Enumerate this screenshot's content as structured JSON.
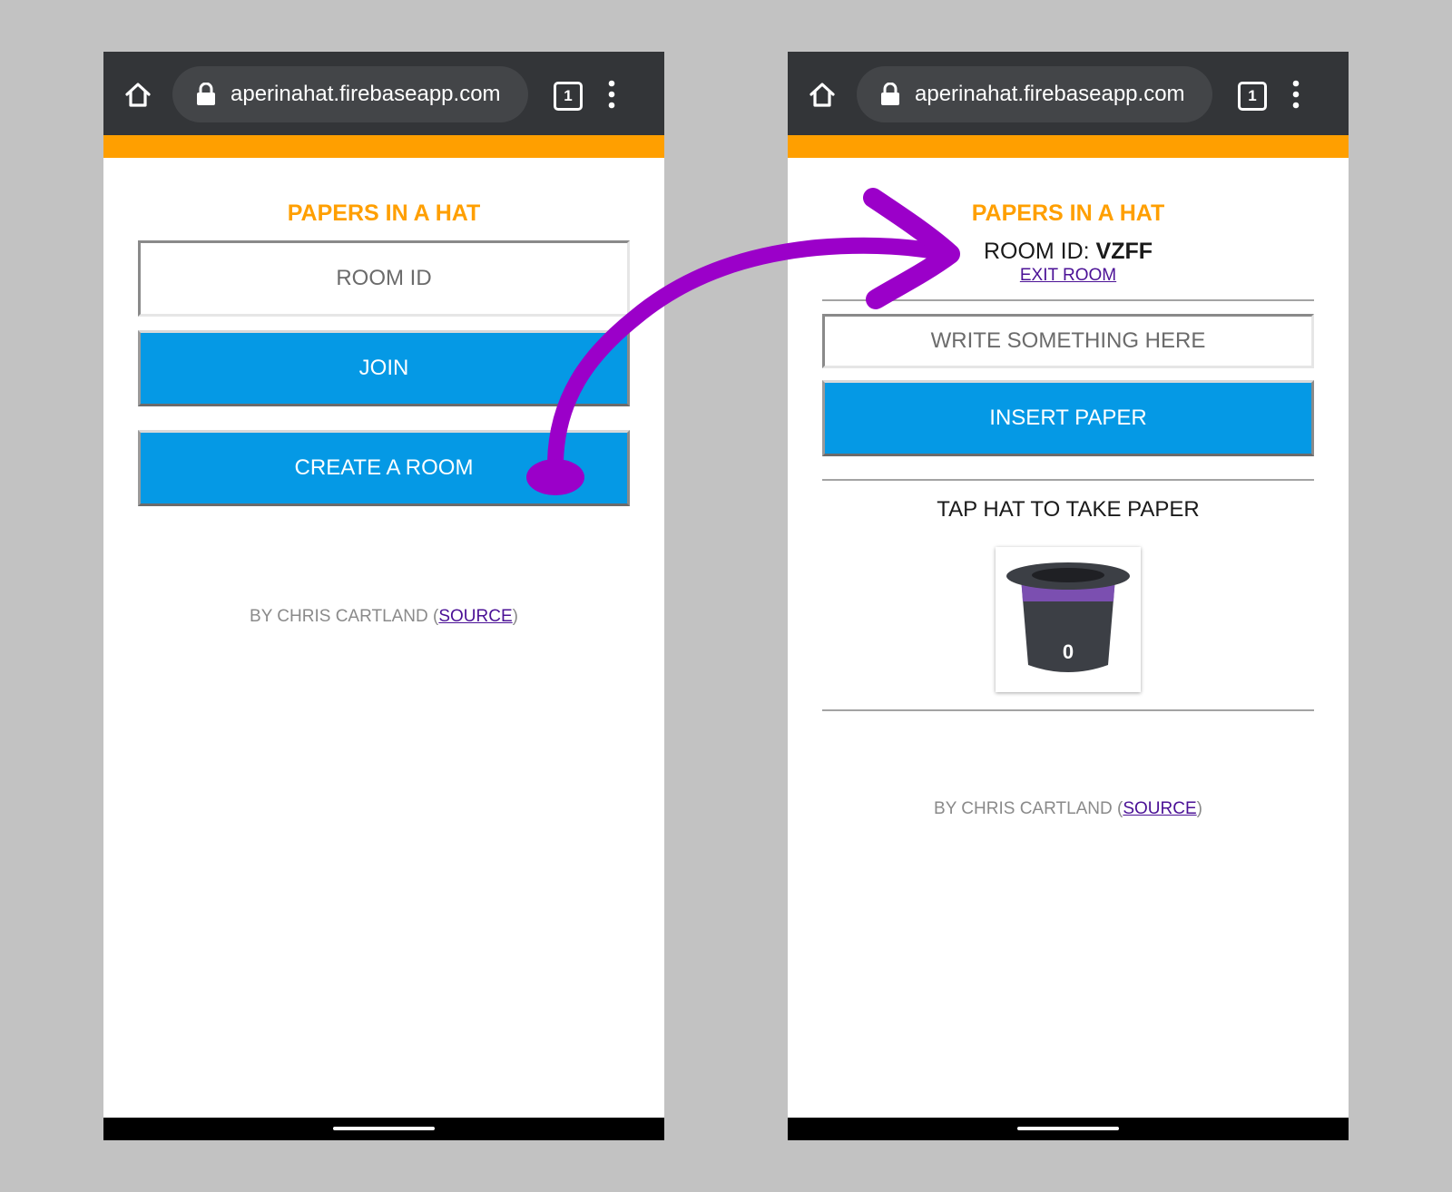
{
  "colors": {
    "background": "#c2c2c2",
    "browser_bar": "#333538",
    "accent": "#ff9f00",
    "button_blue": "#0599e5",
    "link_purple": "#4b1196",
    "hat_band": "#7b4fb0",
    "hat_body": "#3c3f45",
    "arrow": "#9b00c9"
  },
  "icons": {
    "home": "home-icon",
    "lock": "lock-icon",
    "tabs": "tabs-icon",
    "more": "more-vert-icon",
    "hat": "top-hat-icon"
  },
  "left_screen": {
    "browser": {
      "url": "aperinahat.firebaseapp.com",
      "tab_count": "1"
    },
    "title": "PAPERS IN A HAT",
    "room_id_placeholder": "ROOM ID",
    "join_label": "JOIN",
    "create_label": "CREATE A ROOM",
    "footer": {
      "prefix": "BY CHRIS CARTLAND (",
      "link": "SOURCE",
      "suffix": ")"
    }
  },
  "right_screen": {
    "browser": {
      "url": "aperinahat.firebaseapp.com",
      "tab_count": "1"
    },
    "title": "PAPERS IN A HAT",
    "room_id_label": "ROOM ID: ",
    "room_id_value": "VZFF",
    "exit_label": "EXIT ROOM",
    "write_placeholder": "WRITE SOMETHING HERE",
    "insert_label": "INSERT PAPER",
    "tap_label": "TAP HAT TO TAKE PAPER",
    "hat_count": "0",
    "footer": {
      "prefix": "BY CHRIS CARTLAND (",
      "link": "SOURCE",
      "suffix": ")"
    }
  }
}
